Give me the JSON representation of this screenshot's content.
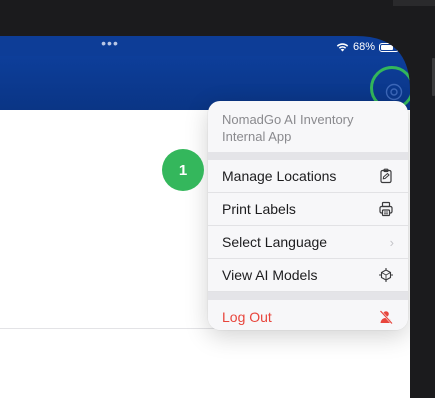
{
  "status_bar": {
    "dots": "•••",
    "battery_text": "68%",
    "battery_level": 0.68
  },
  "menu": {
    "header": "NomadGo AI Inventory Internal App",
    "items": [
      {
        "label": "Manage Locations",
        "icon": "clipboard-icon"
      },
      {
        "label": "Print Labels",
        "icon": "printer-icon"
      },
      {
        "label": "Select Language",
        "icon": "chevron-right-icon",
        "chevron": "›"
      },
      {
        "label": "View AI Models",
        "icon": "model-icon"
      }
    ],
    "logout": {
      "label": "Log Out",
      "icon": "logout-icon"
    }
  },
  "annotation": {
    "badge": "1"
  },
  "colors": {
    "app_bar": "#0d3e9a",
    "accent_green": "#34b75c",
    "danger": "#e8453c"
  }
}
